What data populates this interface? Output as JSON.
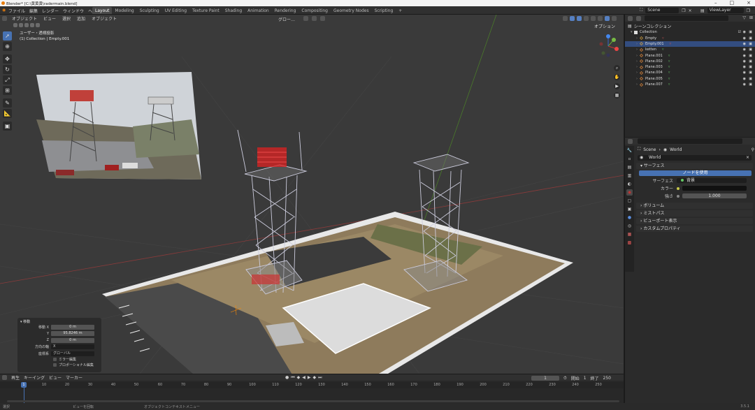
{
  "titlebar": {
    "title": "Blender* [C:\\黄黄黄\\radermain.blend]"
  },
  "menu": [
    "ファイル",
    "編集",
    "レンダー",
    "ウィンドウ",
    "ヘルプ"
  ],
  "workspaces": [
    "Layout",
    "Modeling",
    "Sculpting",
    "UV Editing",
    "Texture Paint",
    "Shading",
    "Animation",
    "Rendering",
    "Compositing",
    "Geometry Nodes",
    "Scripting"
  ],
  "workspace_add": "+",
  "scene": {
    "label": "Scene",
    "viewlayer": "ViewLayer"
  },
  "viewport": {
    "header": [
      "オブジェクト",
      "ビュー",
      "選択",
      "追加",
      "オブジェクト"
    ],
    "orientation": "グロー…",
    "options": "オプション",
    "info_line1": "ユーザー・透視投影",
    "info_line2": "(1) Collection | Empty.001"
  },
  "operator_panel": {
    "title": "移動",
    "rows": [
      {
        "label": "移動 X",
        "value": "0 m"
      },
      {
        "label": "Y",
        "value": "95.8246 m"
      },
      {
        "label": "Z",
        "value": "0 m"
      }
    ],
    "axis_label": "方向の軸",
    "axis_value": "X",
    "orient_label": "座標系",
    "orient_value": "グローバル",
    "check1": "ミラー編集",
    "check2": "プロポーショナル編集"
  },
  "timeline": {
    "menus": [
      "再生",
      "キーイング",
      "ビュー",
      "マーカー"
    ],
    "current_frame": "1",
    "start_label": "開始",
    "start": "1",
    "end_label": "終了",
    "end": "250",
    "ticks": [
      "10",
      "20",
      "30",
      "40",
      "50",
      "60",
      "70",
      "80",
      "90",
      "100",
      "110",
      "120",
      "130",
      "140",
      "150",
      "160",
      "170",
      "180",
      "190",
      "200",
      "210",
      "220",
      "230",
      "240",
      "250"
    ],
    "playhead": "1"
  },
  "statusbar": {
    "left": "選択",
    "middle": "ビューを回転",
    "mid2": "オブジェクトコンテキストメニュー",
    "version": "3.5.1"
  },
  "outliner": {
    "root": "シーンコレクション",
    "collection": "Collection",
    "items": [
      {
        "name": "Empty",
        "selected": false,
        "type": "empty"
      },
      {
        "name": "Empty.001",
        "selected": true,
        "type": "empty"
      },
      {
        "name": "ketten",
        "selected": false,
        "type": "mesh"
      },
      {
        "name": "Plane.001",
        "selected": false,
        "type": "mesh"
      },
      {
        "name": "Plane.002",
        "selected": false,
        "type": "mesh"
      },
      {
        "name": "Plane.003",
        "selected": false,
        "type": "mesh"
      },
      {
        "name": "Plane.004",
        "selected": false,
        "type": "mesh"
      },
      {
        "name": "Plane.005",
        "selected": false,
        "type": "mesh"
      },
      {
        "name": "Plane.007",
        "selected": false,
        "type": "mesh"
      }
    ]
  },
  "properties": {
    "breadcrumb_scene": "Scene",
    "breadcrumb_world": "World",
    "world_name": "World",
    "surface_section": "サーフェス",
    "use_nodes": "ノードを使用",
    "surface_label": "サーフェス",
    "surface_value": "背景",
    "color_label": "カラー",
    "strength_label": "強さ",
    "strength_value": "1.000",
    "sections": [
      "ボリューム",
      "ミストパス",
      "ビューポート表示",
      "カスタムプロパティ"
    ]
  },
  "colors": {
    "accent": "#4772b3",
    "selected_row": "#334d80",
    "empty_icon": "#d6a13c",
    "mesh_icon": "#e58a3a"
  }
}
